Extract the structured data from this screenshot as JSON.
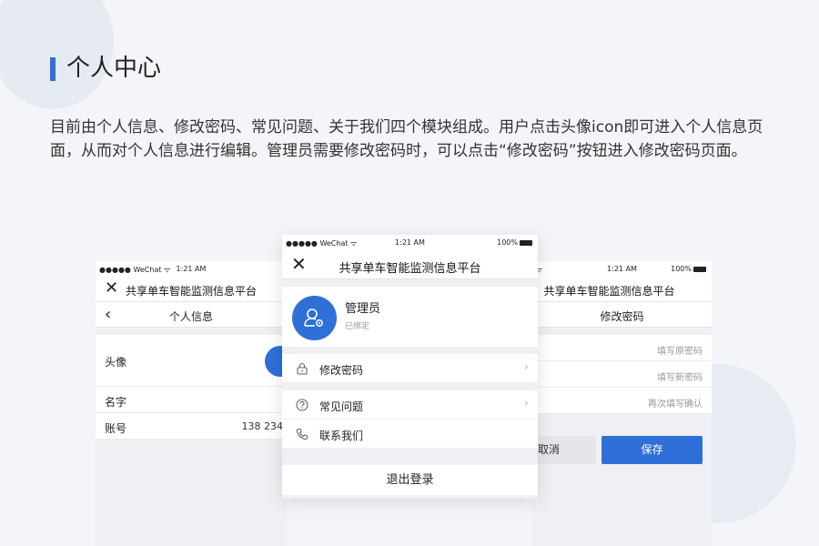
{
  "page": {
    "title": "个人中心",
    "description": "目前由个人信息、修改密码、常见问题、关于我们四个模块组成。用户点击头像icon即可进入个人信息页面，从而对个人信息进行编辑。管理员需要修改密码时，可以点击“修改密码”按钮进入修改密码页面。"
  },
  "status": {
    "carrier": "●●●●● WeChat ᯤ",
    "time": "1:21 AM",
    "battery": "100%"
  },
  "app_title": "共享单车智能监测信息平台",
  "left_phone": {
    "subtitle": "个人信息",
    "avatar_label": "头像",
    "name_label": "名字",
    "account_label": "账号",
    "account_value": "138 234"
  },
  "center_phone": {
    "user_name": "管理员",
    "bound_status": "已绑定",
    "menu": [
      {
        "label": "修改密码",
        "icon": "lock-icon"
      },
      {
        "label": "常见问题",
        "icon": "question-icon"
      },
      {
        "label": "联系我们",
        "icon": "phone-icon"
      }
    ],
    "logout": "退出登录"
  },
  "right_phone": {
    "subtitle": "修改密码",
    "old_password_placeholder": "填写原密码",
    "new_password_placeholder": "填写新密码",
    "confirm_placeholder": "再次填写确认",
    "cancel": "取消",
    "save": "保存"
  },
  "colors": {
    "accent": "#2f6fd8",
    "background": "#f3f5f9"
  }
}
